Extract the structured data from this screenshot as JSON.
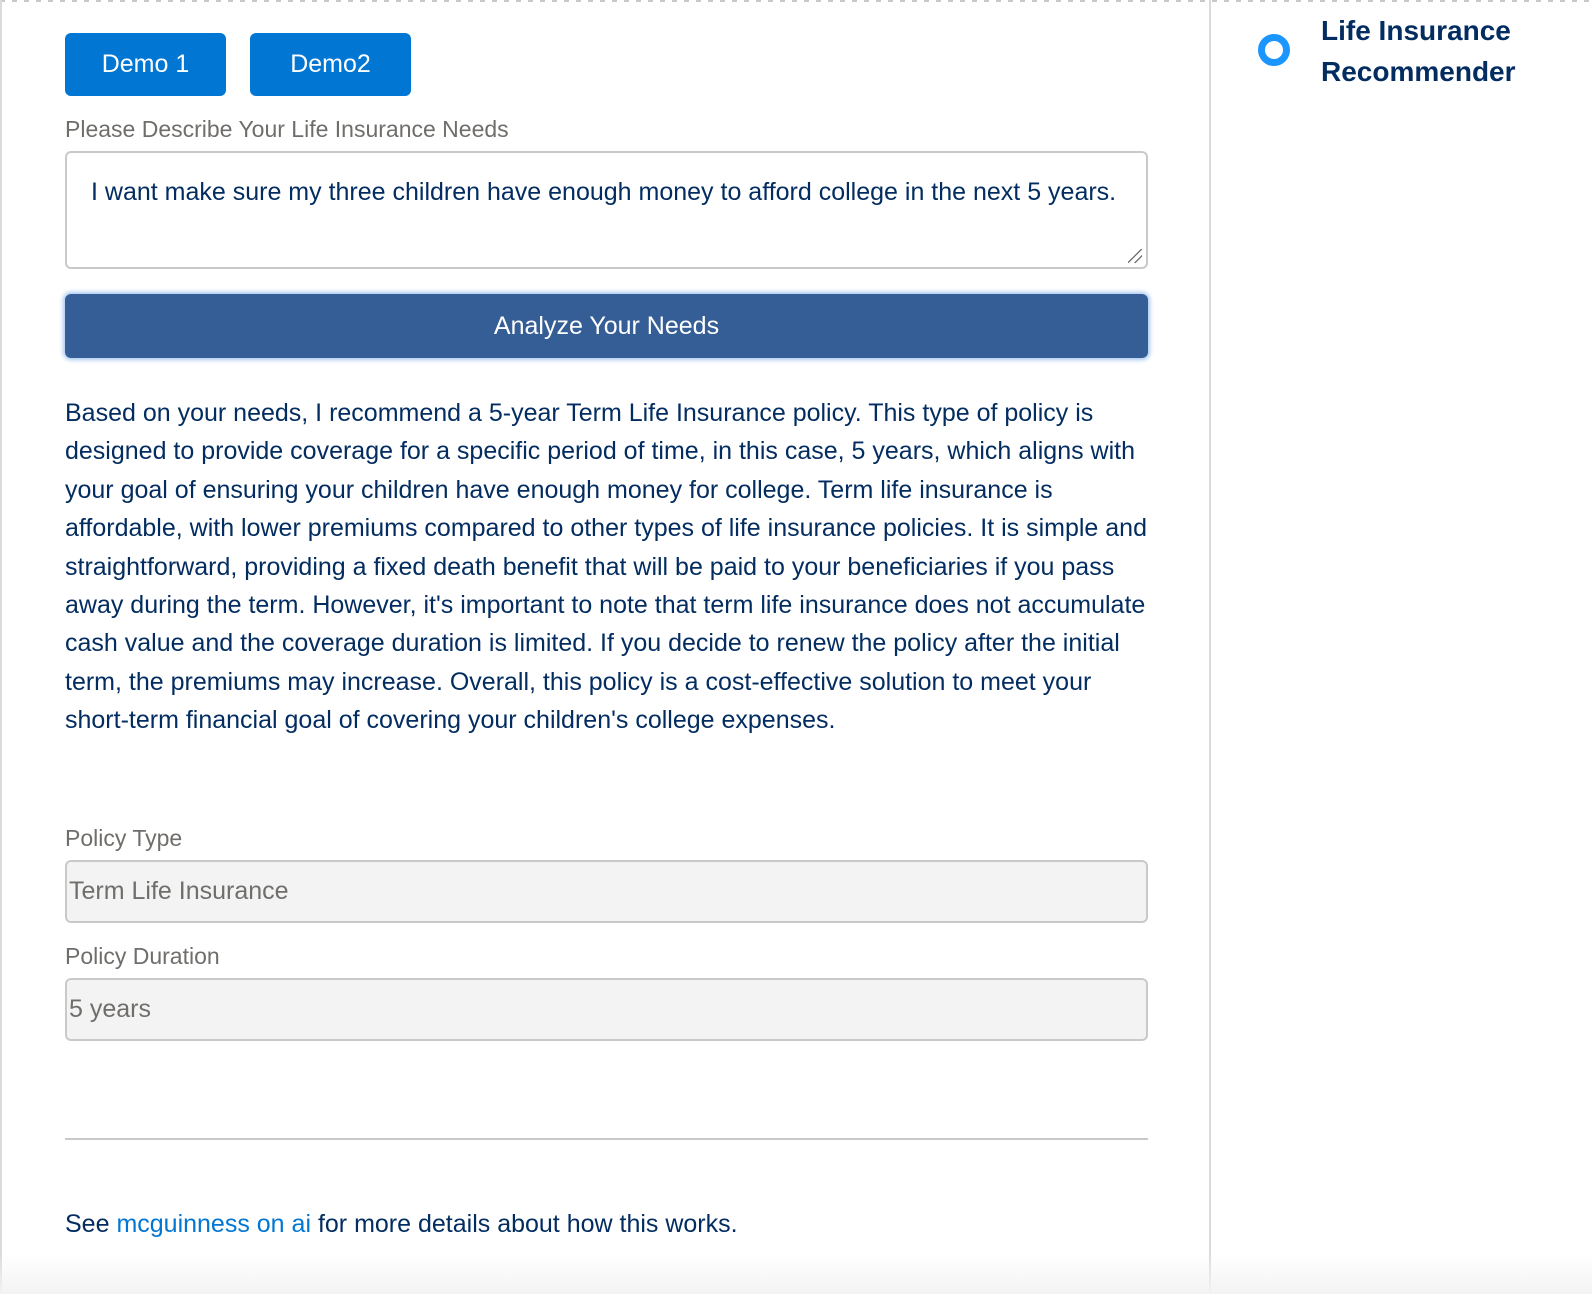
{
  "demo_buttons": {
    "demo1_label": "Demo 1",
    "demo2_label": "Demo2"
  },
  "needs": {
    "label": "Please Describe Your Life Insurance Needs",
    "value": "I want make sure my three children have enough money to afford college in the next 5 years."
  },
  "analyze_button_label": "Analyze Your Needs",
  "recommendation_text": "Based on your needs, I recommend a 5-year Term Life Insurance policy. This type of policy is designed to provide coverage for a specific period of time, in this case, 5 years, which aligns with your goal of ensuring your children have enough money for college. Term life insurance is affordable, with lower premiums compared to other types of life insurance policies. It is simple and straightforward, providing a fixed death benefit that will be paid to your beneficiaries if you pass away during the term. However, it's important to note that term life insurance does not accumulate cash value and the coverage duration is limited. If you decide to renew the policy after the initial term, the premiums may increase. Overall, this policy is a cost-effective solution to meet your short-term financial goal of covering your children's college expenses.",
  "policy_type": {
    "label": "Policy Type",
    "value": "Term Life Insurance"
  },
  "policy_duration": {
    "label": "Policy Duration",
    "value": "5 years"
  },
  "footer": {
    "prefix": "See",
    "link_text": "mcguinness on ai",
    "suffix": "for more details about how this works."
  },
  "sidebar": {
    "step_icon": "circle-ring-icon",
    "step_title": "Life Insurance Recommender"
  },
  "colors": {
    "brand_blue": "#0176d3",
    "analyze_button": "#355e96",
    "text_navy": "#032d60",
    "label_gray": "#706e6b",
    "ring_blue": "#1b96ff"
  }
}
